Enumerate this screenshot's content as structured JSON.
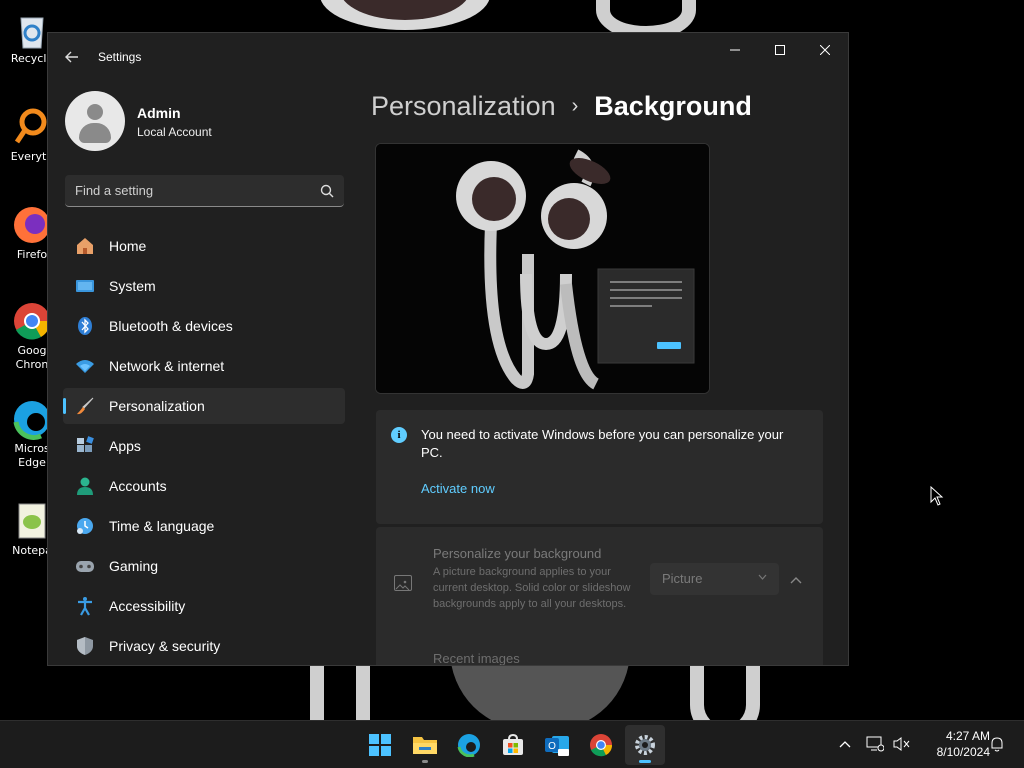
{
  "desktop": {
    "icons": [
      {
        "label": "Recycle",
        "icon": "recycle-bin-icon"
      },
      {
        "label": "Everyth",
        "icon": "everything-search-icon"
      },
      {
        "label": "Firefo",
        "icon": "firefox-icon"
      },
      {
        "label": "Goog\nChron",
        "icon": "chrome-icon"
      },
      {
        "label": "Micros\nEdge",
        "icon": "edge-icon"
      },
      {
        "label": "Notepa",
        "icon": "notepad-plus-plus-icon"
      }
    ]
  },
  "window": {
    "title": "Settings",
    "controls": {
      "minimize": "—",
      "maximize": "☐",
      "close": "✕"
    }
  },
  "user": {
    "name": "Admin",
    "account_type": "Local Account"
  },
  "search": {
    "placeholder": "Find a setting"
  },
  "nav": {
    "items": [
      {
        "label": "Home",
        "icon": "home-icon",
        "active": false
      },
      {
        "label": "System",
        "icon": "system-icon",
        "active": false
      },
      {
        "label": "Bluetooth & devices",
        "icon": "bluetooth-icon",
        "active": false
      },
      {
        "label": "Network & internet",
        "icon": "network-icon",
        "active": false
      },
      {
        "label": "Personalization",
        "icon": "personalization-brush-icon",
        "active": true
      },
      {
        "label": "Apps",
        "icon": "apps-icon",
        "active": false
      },
      {
        "label": "Accounts",
        "icon": "accounts-icon",
        "active": false
      },
      {
        "label": "Time & language",
        "icon": "time-language-icon",
        "active": false
      },
      {
        "label": "Gaming",
        "icon": "gaming-icon",
        "active": false
      },
      {
        "label": "Accessibility",
        "icon": "accessibility-icon",
        "active": false
      },
      {
        "label": "Privacy & security",
        "icon": "privacy-shield-icon",
        "active": false
      }
    ]
  },
  "breadcrumb": {
    "parent": "Personalization",
    "separator": "›",
    "current": "Background"
  },
  "notice": {
    "text": "You need to activate Windows before you can personalize your PC.",
    "link": "Activate now"
  },
  "background_card": {
    "title": "Personalize your background",
    "description": "A picture background applies to your current desktop. Solid color or slideshow backgrounds apply to all your desktops.",
    "select_value": "Picture",
    "recent_label": "Recent images"
  },
  "taskbar": {
    "apps": [
      {
        "name": "start-button",
        "active": false
      },
      {
        "name": "file-explorer",
        "active": false
      },
      {
        "name": "edge",
        "active": false
      },
      {
        "name": "microsoft-store",
        "active": false
      },
      {
        "name": "outlook-new",
        "active": false
      },
      {
        "name": "chrome",
        "active": false
      },
      {
        "name": "settings",
        "active": true
      }
    ],
    "time": "4:27 AM",
    "date": "8/10/2024"
  },
  "colors": {
    "accent": "#60cdff",
    "window_bg": "#202020",
    "card_bg": "#2b2b2b"
  }
}
